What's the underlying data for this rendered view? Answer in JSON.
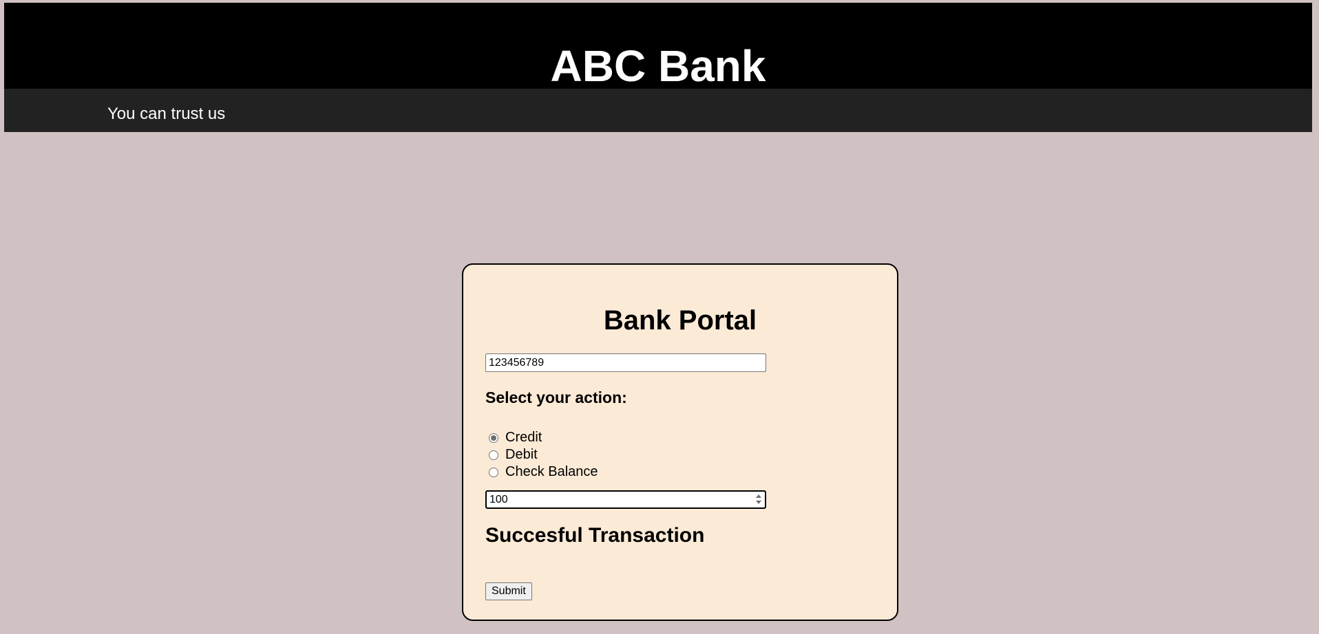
{
  "header": {
    "title": "ABC Bank",
    "tagline": "You can trust us"
  },
  "portal": {
    "title": "Bank Portal",
    "account_number": "123456789",
    "action_label": "Select your action:",
    "actions": [
      {
        "label": "Credit",
        "checked": true
      },
      {
        "label": "Debit",
        "checked": false
      },
      {
        "label": "Check Balance",
        "checked": false
      }
    ],
    "amount": "100",
    "status_message": "Succesful Transaction",
    "submit_label": "Submit"
  }
}
